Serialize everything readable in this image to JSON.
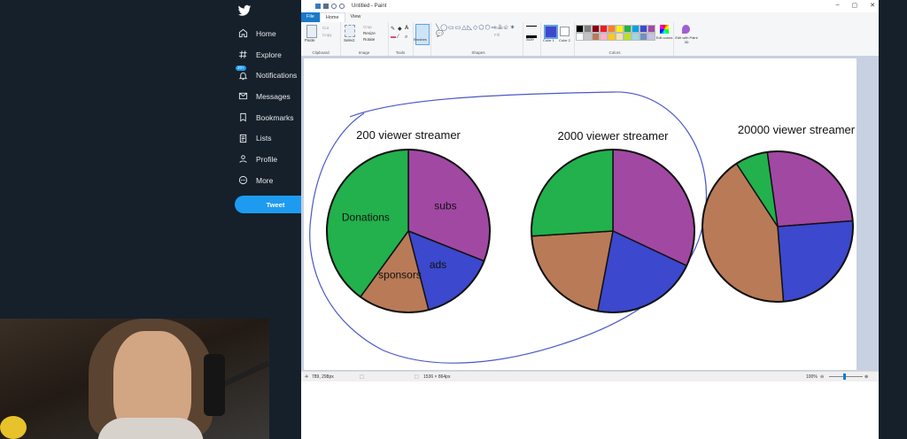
{
  "twitter": {
    "nav": [
      {
        "label": "Home",
        "icon": "home-icon"
      },
      {
        "label": "Explore",
        "icon": "hashtag-icon"
      },
      {
        "label": "Notifications",
        "icon": "bell-icon",
        "badge": "20+"
      },
      {
        "label": "Messages",
        "icon": "mail-icon"
      },
      {
        "label": "Bookmarks",
        "icon": "bookmark-icon"
      },
      {
        "label": "Lists",
        "icon": "list-icon"
      },
      {
        "label": "Profile",
        "icon": "person-icon"
      },
      {
        "label": "More",
        "icon": "more-icon"
      }
    ],
    "tweet_button": "Tweet",
    "accent": "#1d9bf0"
  },
  "paint": {
    "title": "Untitled - Paint",
    "menu": {
      "file": "File",
      "home": "Home",
      "view": "View"
    },
    "ribbon": {
      "clipboard": {
        "label": "Clipboard",
        "paste": "Paste",
        "cut": "Cut",
        "copy": "Copy"
      },
      "image": {
        "label": "Image",
        "select": "Select",
        "crop": "Crop",
        "resize": "Resize",
        "rotate": "Rotate"
      },
      "tools": {
        "label": "Tools"
      },
      "brushes": "Brushes",
      "shapes": {
        "label": "Shapes",
        "outline": "Outline",
        "fill": "Fill"
      },
      "size": "Size",
      "color1": "Color 1",
      "color2": "Color 2",
      "colors_label": "Colors",
      "edit_colors": "Edit colors",
      "edit_paint3d": "Edit with Paint 3D"
    },
    "palette": [
      "#000000",
      "#7f7f7f",
      "#880015",
      "#ed1c24",
      "#ff7f27",
      "#fff200",
      "#22b14c",
      "#00a2e8",
      "#3f48cc",
      "#a349a4",
      "#ffffff",
      "#c3c3c3",
      "#b97a57",
      "#ffaec9",
      "#ffc90e",
      "#efe4b0",
      "#b5e61d",
      "#99d9ea",
      "#7092be",
      "#c8bfe7"
    ],
    "status": {
      "cursor": "789, 298px",
      "size": "1536 × 864px",
      "zoom": "100%"
    }
  },
  "chart_data": [
    {
      "type": "pie",
      "title": "200 viewer streamer",
      "slices": [
        {
          "label": "subs",
          "value": 31,
          "color": "#a148a3"
        },
        {
          "label": "ads",
          "value": 15,
          "color": "#3c48cd"
        },
        {
          "label": "sponsors",
          "value": 14,
          "color": "#b97a57"
        },
        {
          "label": "Donations",
          "value": 40,
          "color": "#22b14c"
        }
      ]
    },
    {
      "type": "pie",
      "title": "2000 viewer streamer",
      "slices": [
        {
          "label": "",
          "value": 32,
          "color": "#a148a3"
        },
        {
          "label": "",
          "value": 21,
          "color": "#3c48cd"
        },
        {
          "label": "",
          "value": 21,
          "color": "#b97a57"
        },
        {
          "label": "",
          "value": 26,
          "color": "#22b14c"
        }
      ]
    },
    {
      "type": "pie",
      "title": "20000 viewer streamer",
      "slices": [
        {
          "label": "",
          "value": 26,
          "color": "#a148a3"
        },
        {
          "label": "",
          "value": 25,
          "color": "#3c48cd"
        },
        {
          "label": "",
          "value": 42,
          "color": "#b97a57"
        },
        {
          "label": "",
          "value": 7,
          "color": "#22b14c"
        }
      ]
    }
  ]
}
